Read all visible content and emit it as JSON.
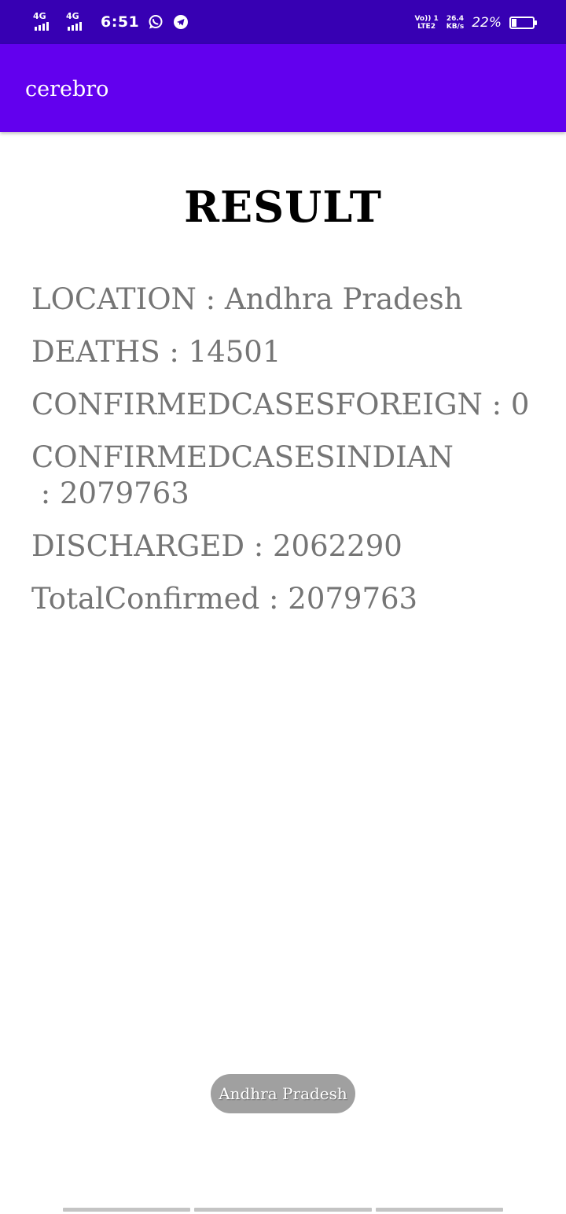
{
  "status_bar": {
    "sim1_network": "4G",
    "sim2_network": "4G",
    "time": "6:51",
    "volte_top": "Vo)) 1",
    "volte_bottom": "LTE2",
    "speed_value": "26.4",
    "speed_unit": "KB/s",
    "battery_percent": "22%",
    "battery_level": 0.22,
    "icons": [
      "signal-icon",
      "signal-icon",
      "whatsapp-icon",
      "telegram-icon",
      "battery-icon"
    ],
    "color": "#3700b3"
  },
  "app_bar": {
    "title": "cerebro",
    "color": "#6200ee"
  },
  "content": {
    "heading": "RESULT",
    "separator": " : ",
    "fields": [
      {
        "label": "LOCATION",
        "value": "Andhra Pradesh"
      },
      {
        "label": "DEATHS",
        "value": "14501"
      },
      {
        "label": "CONFIRMEDCASESFOREIGN",
        "value": "0"
      },
      {
        "label": "CONFIRMEDCASESINDIAN",
        "value": "2079763"
      },
      {
        "label": "DISCHARGED",
        "value": "2062290"
      },
      {
        "label": "TotalConfirmed",
        "value": "2079763"
      }
    ],
    "text_color": "#757575"
  },
  "toast": {
    "text": "Andhra Pradesh"
  }
}
